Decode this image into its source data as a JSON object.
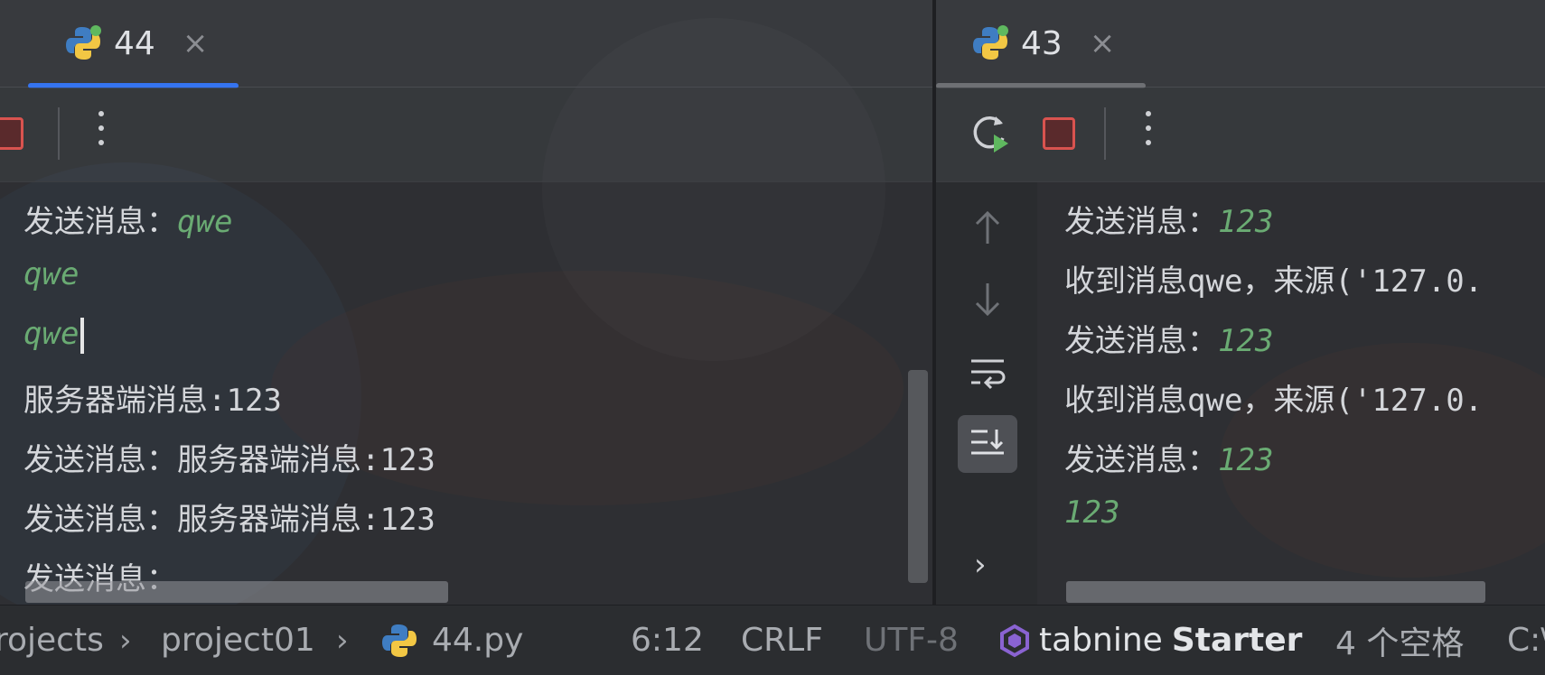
{
  "left": {
    "tab": {
      "label": "44",
      "close": "×",
      "icon": "python-icon"
    },
    "console_lines": [
      {
        "prefix": "发送消息：",
        "value": "qwe"
      },
      {
        "prefix": "",
        "value": "qwe"
      },
      {
        "prefix": "",
        "value": "qwe"
      },
      {
        "prefix": "服务器端消息:123",
        "value": ""
      },
      {
        "prefix": "发送消息：服务器端消息:123",
        "value": ""
      },
      {
        "prefix": "发送消息：服务器端消息:123",
        "value": ""
      },
      {
        "prefix": "发送消息：",
        "value": ""
      }
    ]
  },
  "right": {
    "tab": {
      "label": "43",
      "close": "×",
      "icon": "python-icon"
    },
    "console_lines": [
      {
        "prefix": "发送消息：",
        "value": "123"
      },
      {
        "prefix": "收到消息qwe，来源('127.0.",
        "value": ""
      },
      {
        "prefix": "发送消息：",
        "value": "123"
      },
      {
        "prefix": "收到消息qwe，来源('127.0.",
        "value": ""
      },
      {
        "prefix": "发送消息：",
        "value": "123"
      },
      {
        "prefix": "",
        "value": "123"
      }
    ]
  },
  "status": {
    "crumb1": "rojects",
    "crumb2": "project01",
    "file": "44.py",
    "position": "6:12",
    "line_sep": "CRLF",
    "encoding": "UTF-8",
    "tabnine": "tabnine",
    "tabnine_plan": "Starter",
    "indent": "4 个空格",
    "path": "C:\\"
  },
  "colors": {
    "accent": "#3574f0",
    "output_green": "#6aab73",
    "stop_red": "#d9534f"
  }
}
